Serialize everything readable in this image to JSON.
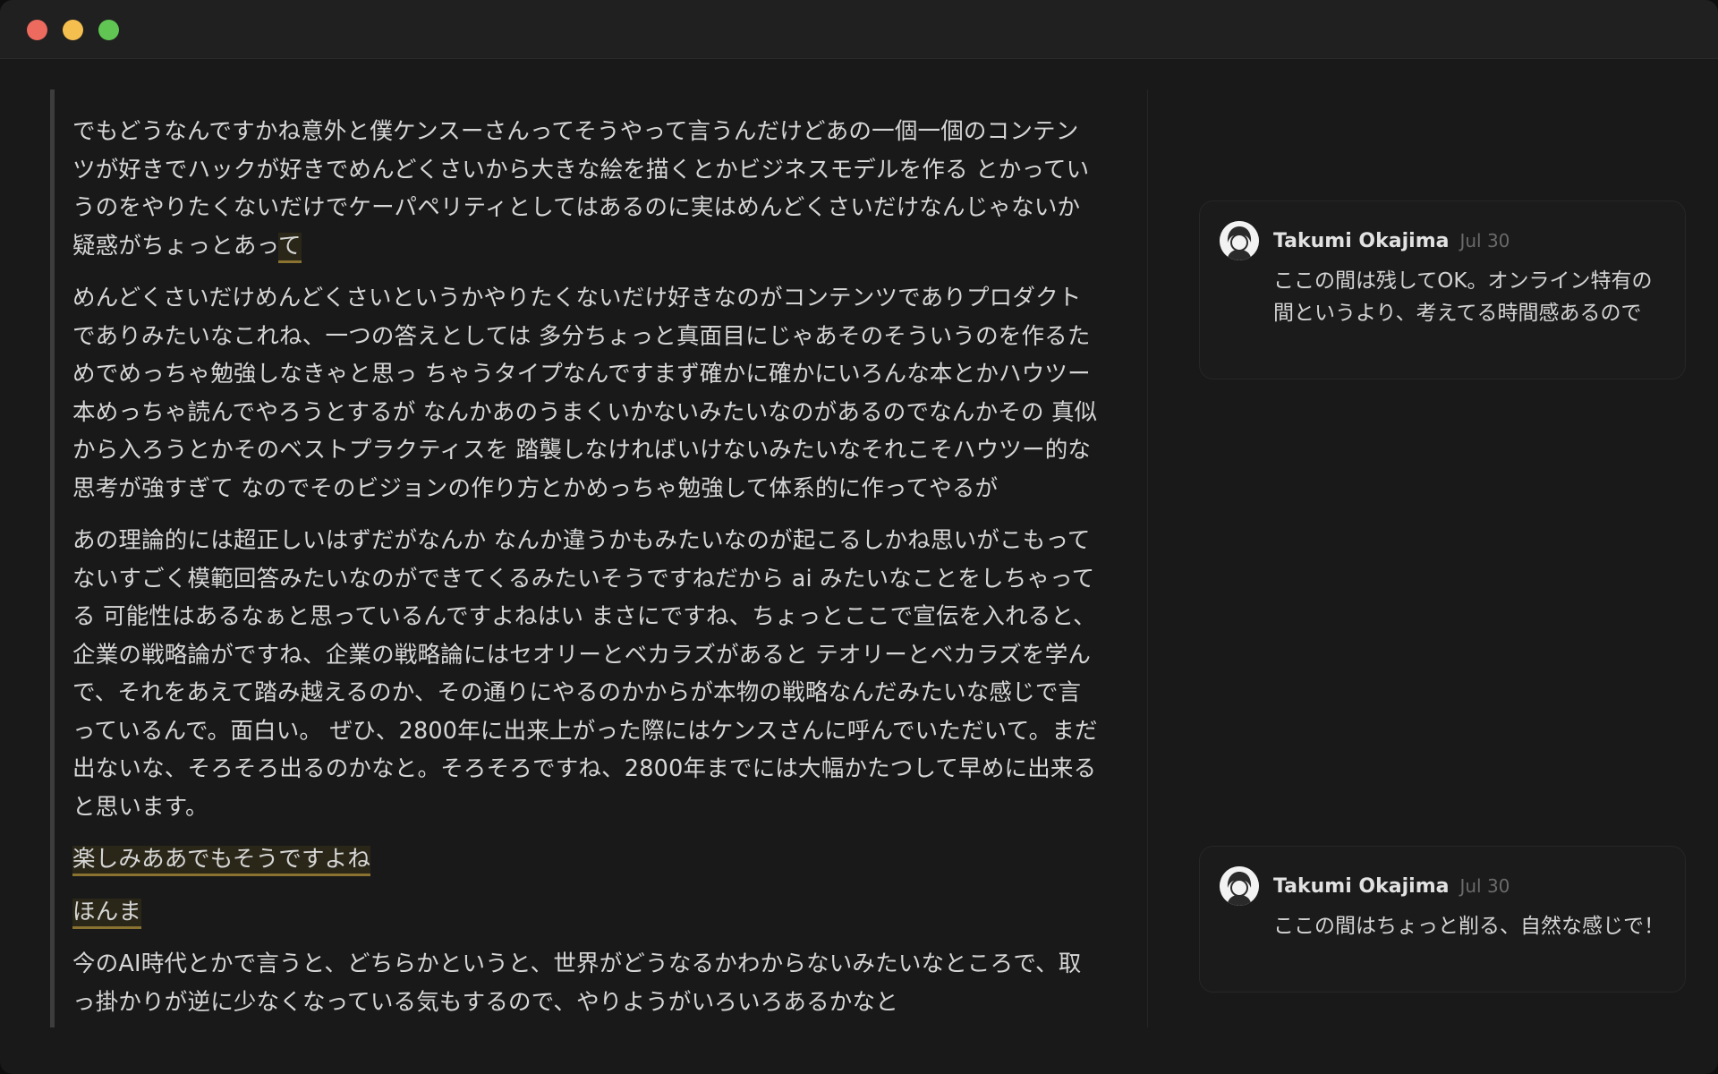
{
  "editor": {
    "paragraphs": [
      {
        "text": "でもどうなんですかね意外と僕ケンスーさんってそうやって言うんだけどあの一個一個のコンテンツが好きでハックが好きでめんどくさいから大きな絵を描くとかビジネスモデルを作る とかっていうのをやりたくないだけでケーパペリティとしてはあるのに実はめんどくさいだけなんじゃないか疑惑がちょっとあっ",
        "highlight": "て"
      },
      {
        "text": "めんどくさいだけめんどくさいというかやりたくないだけ好きなのがコンテンツでありプロダクトでありみたいなこれね、一つの答えとしては 多分ちょっと真面目にじゃあそのそういうのを作るためでめっちゃ勉強しなきゃと思っ ちゃうタイプなんですまず確かに確かにいろんな本とかハウツー本めっちゃ読んでやろうとするが なんかあのうまくいかないみたいなのがあるのでなんかその 真似から入ろうとかそのベストプラクティスを 踏襲しなければいけないみたいなそれこそハウツー的な思考が強すぎて なのでそのビジョンの作り方とかめっちゃ勉強して体系的に作ってやるが"
      },
      {
        "text": "あの理論的には超正しいはずだがなんか なんか違うかもみたいなのが起こるしかね思いがこもってないすごく模範回答みたいなのができてくるみたいそうですねだから ai みたいなことをしちゃってる 可能性はあるなぁと思っているんですよねはい まさにですね、ちょっとここで宣伝を入れると、企業の戦略論がですね、企業の戦略論にはセオリーとベカラズがあると テオリーとベカラズを学んで、それをあえて踏み越えるのか、その通りにやるのかからが本物の戦略なんだみたいな感じで言っているんで。面白い。 ぜひ、2800年に出来上がった際にはケンスさんに呼んでいただいて。まだ出ないな、そろそろ出るのかなと。そろそろですね、2800年までには大幅かたつして早めに出来ると思います。"
      },
      {
        "highlight": "楽しみああでもそうですよね"
      },
      {
        "highlight": "ほんま"
      },
      {
        "text": "今のAI時代とかで言うと、どちらかというと、世界がどうなるかわからないみたいなところで、取っ掛かりが逆に少なくなっている気もするので、やりようがいろいろあるかなと"
      }
    ]
  },
  "comments": [
    {
      "author": "Takumi Okajima",
      "date": "Jul 30",
      "text": "ここの間は残してOK。オンライン特有の間というより、考えてる時間感あるので"
    },
    {
      "author": "Takumi Okajima",
      "date": "Jul 30",
      "text": "ここの間はちょっと削る、自然な感じで！"
    }
  ]
}
